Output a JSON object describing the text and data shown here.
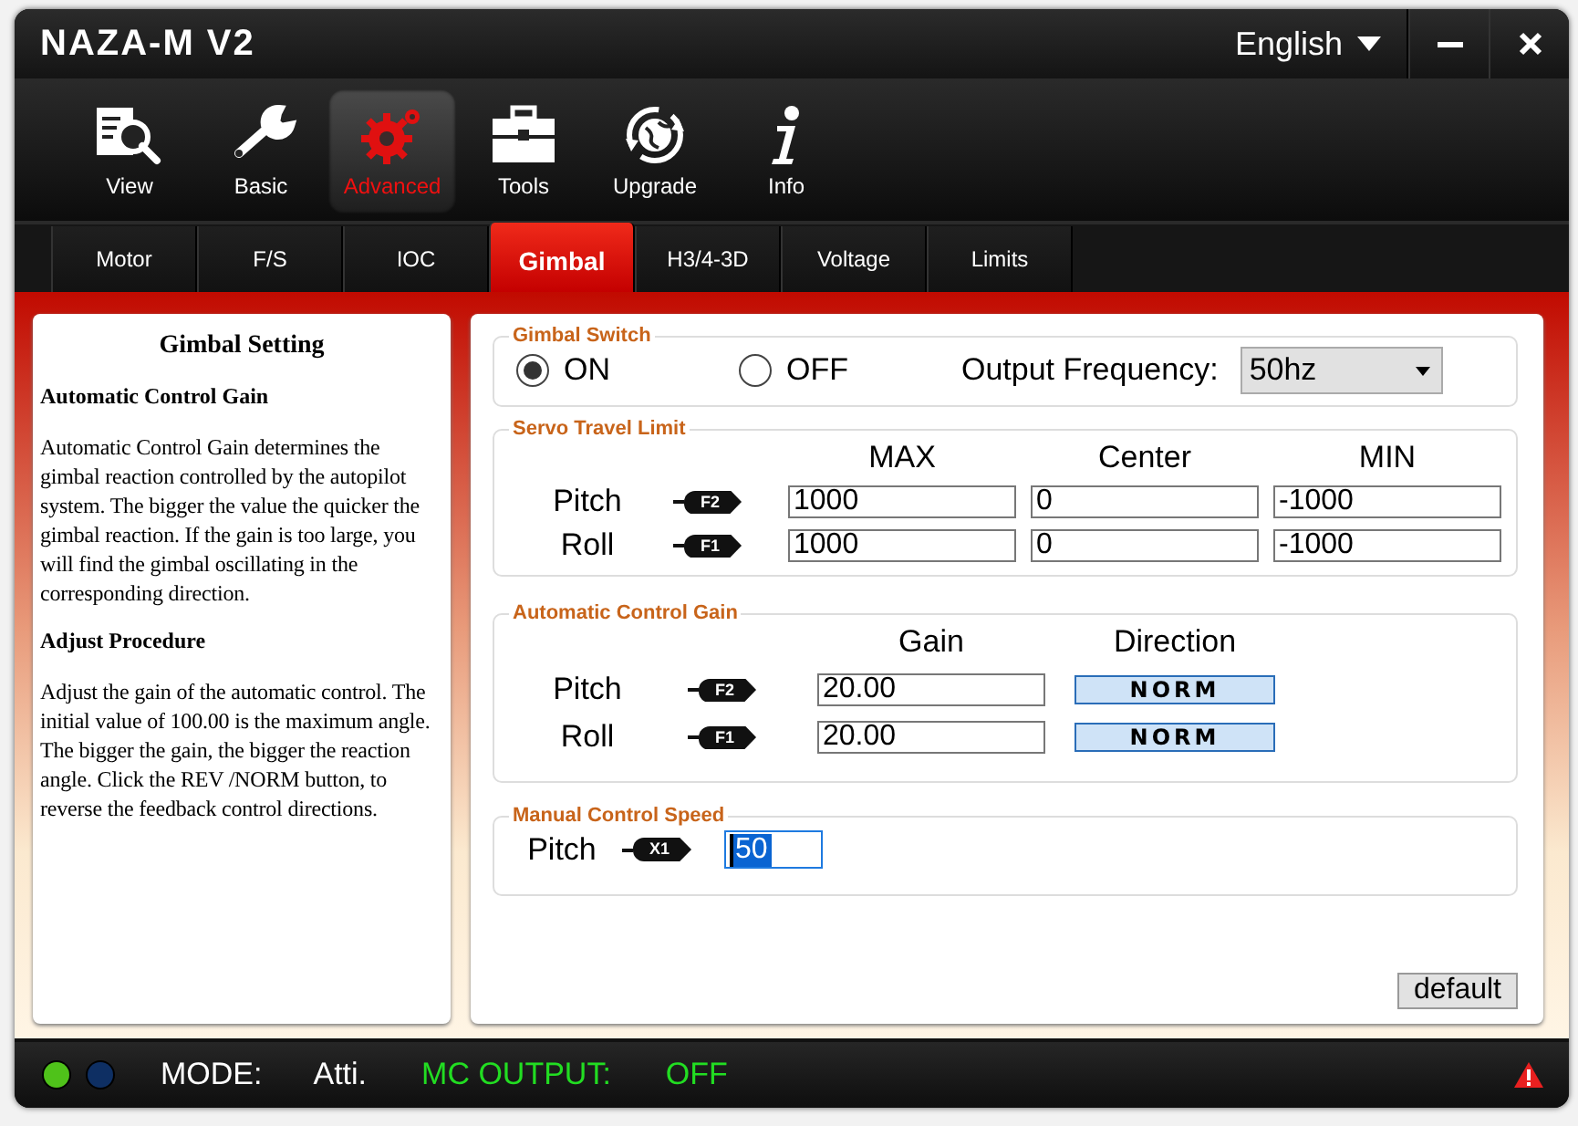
{
  "window": {
    "title": "NAZA-M V2",
    "language": "English"
  },
  "toolbar": [
    {
      "label": "View",
      "selected": false
    },
    {
      "label": "Basic",
      "selected": false
    },
    {
      "label": "Advanced",
      "selected": true
    },
    {
      "label": "Tools",
      "selected": false
    },
    {
      "label": "Upgrade",
      "selected": false
    },
    {
      "label": "Info",
      "selected": false
    }
  ],
  "subtabs": [
    {
      "label": "Motor",
      "selected": false
    },
    {
      "label": "F/S",
      "selected": false
    },
    {
      "label": "IOC",
      "selected": false
    },
    {
      "label": "Gimbal",
      "selected": true
    },
    {
      "label": "H3/4-3D",
      "selected": false
    },
    {
      "label": "Voltage",
      "selected": false
    },
    {
      "label": "Limits",
      "selected": false
    }
  ],
  "help": {
    "title": "Gimbal Setting",
    "sections": [
      {
        "heading": "Automatic Control Gain",
        "body": "Automatic Control Gain determines the gimbal reaction controlled by the autopilot system. The bigger the value the quicker the gimbal reaction. If the gain is too large, you will find the gimbal oscillating in the corresponding direction."
      },
      {
        "heading": "Adjust Procedure",
        "body": "Adjust the gain of the automatic control. The initial value of 100.00 is the maximum angle. The bigger the gain, the bigger the reaction angle. Click the REV /NORM button, to reverse the feedback control directions."
      }
    ]
  },
  "gimbal_switch": {
    "title": "Gimbal Switch",
    "options": [
      {
        "label": "ON",
        "selected": true
      },
      {
        "label": "OFF",
        "selected": false
      }
    ],
    "frequency_label": "Output Frequency:",
    "frequency": "50hz"
  },
  "servo_travel_limit": {
    "title": "Servo Travel Limit",
    "columns": [
      "MAX",
      "Center",
      "MIN"
    ],
    "rows": [
      {
        "name": "Pitch",
        "channel": "F2",
        "values": [
          "1000",
          "0",
          "-1000"
        ]
      },
      {
        "name": "Roll",
        "channel": "F1",
        "values": [
          "1000",
          "0",
          "-1000"
        ]
      }
    ]
  },
  "automatic_control_gain": {
    "title": "Automatic Control Gain",
    "columns": [
      "Gain",
      "Direction"
    ],
    "rows": [
      {
        "name": "Pitch",
        "channel": "F2",
        "gain": "20.00",
        "direction": "NORM"
      },
      {
        "name": "Roll",
        "channel": "F1",
        "gain": "20.00",
        "direction": "NORM"
      }
    ]
  },
  "manual_control_speed": {
    "title": "Manual Control Speed",
    "rows": [
      {
        "name": "Pitch",
        "channel": "X1",
        "value": "50",
        "selected": true
      }
    ]
  },
  "default_button": "default",
  "status_bar": {
    "leds": [
      {
        "color": "#4fc21a"
      },
      {
        "color": "#0e2f63"
      }
    ],
    "mode_label": "MODE:",
    "mode": "Atti.",
    "output_label": "MC OUTPUT:",
    "output": "OFF"
  }
}
